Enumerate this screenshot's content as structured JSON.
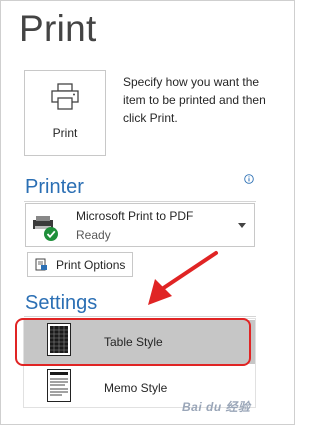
{
  "page": {
    "title": "Print"
  },
  "print_button": {
    "label": "Print",
    "icon": "printer-icon"
  },
  "description": "Specify how you want the item to be printed and then click Print.",
  "printer": {
    "section_title": "Printer",
    "info_icon": "info-icon",
    "selected_name": "Microsoft Print to PDF",
    "selected_status": "Ready",
    "options_label": "Print Options"
  },
  "settings": {
    "section_title": "Settings",
    "styles": [
      {
        "label": "Table Style",
        "icon": "table-style-icon",
        "selected": true
      },
      {
        "label": "Memo Style",
        "icon": "memo-style-icon",
        "selected": false
      }
    ]
  },
  "annotation": {
    "highlight_color": "#e02424"
  },
  "watermark": "Bai du 经验"
}
